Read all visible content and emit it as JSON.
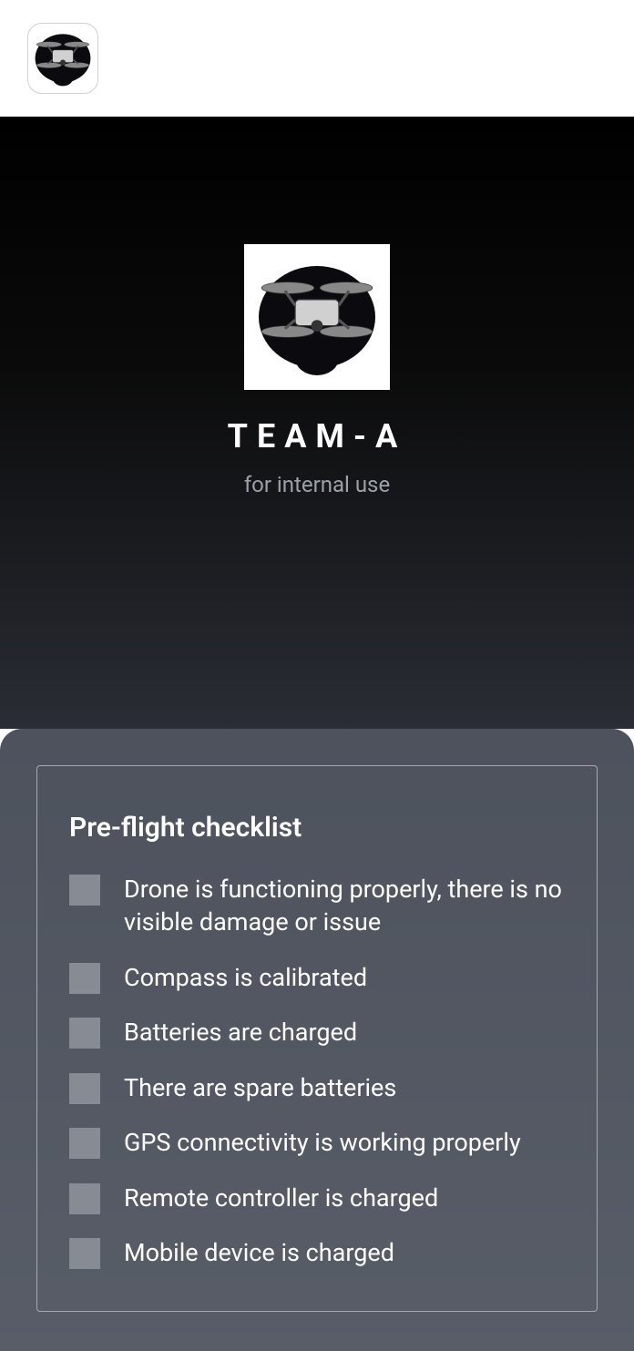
{
  "header": {
    "app_icon_name": "drone-icon"
  },
  "hero": {
    "app_icon_name": "drone-icon",
    "title": "TEAM-A",
    "subtitle": "for internal use"
  },
  "checklist": {
    "title": "Pre-flight checklist",
    "items": [
      {
        "label": "Drone is functioning properly, there is no visible damage or issue",
        "checked": false
      },
      {
        "label": "Compass is calibrated",
        "checked": false
      },
      {
        "label": "Batteries are charged",
        "checked": false
      },
      {
        "label": "There are spare batteries",
        "checked": false
      },
      {
        "label": "GPS connectivity is working properly",
        "checked": false
      },
      {
        "label": "Remote controller is charged",
        "checked": false
      },
      {
        "label": "Mobile device is charged",
        "checked": false
      }
    ]
  }
}
